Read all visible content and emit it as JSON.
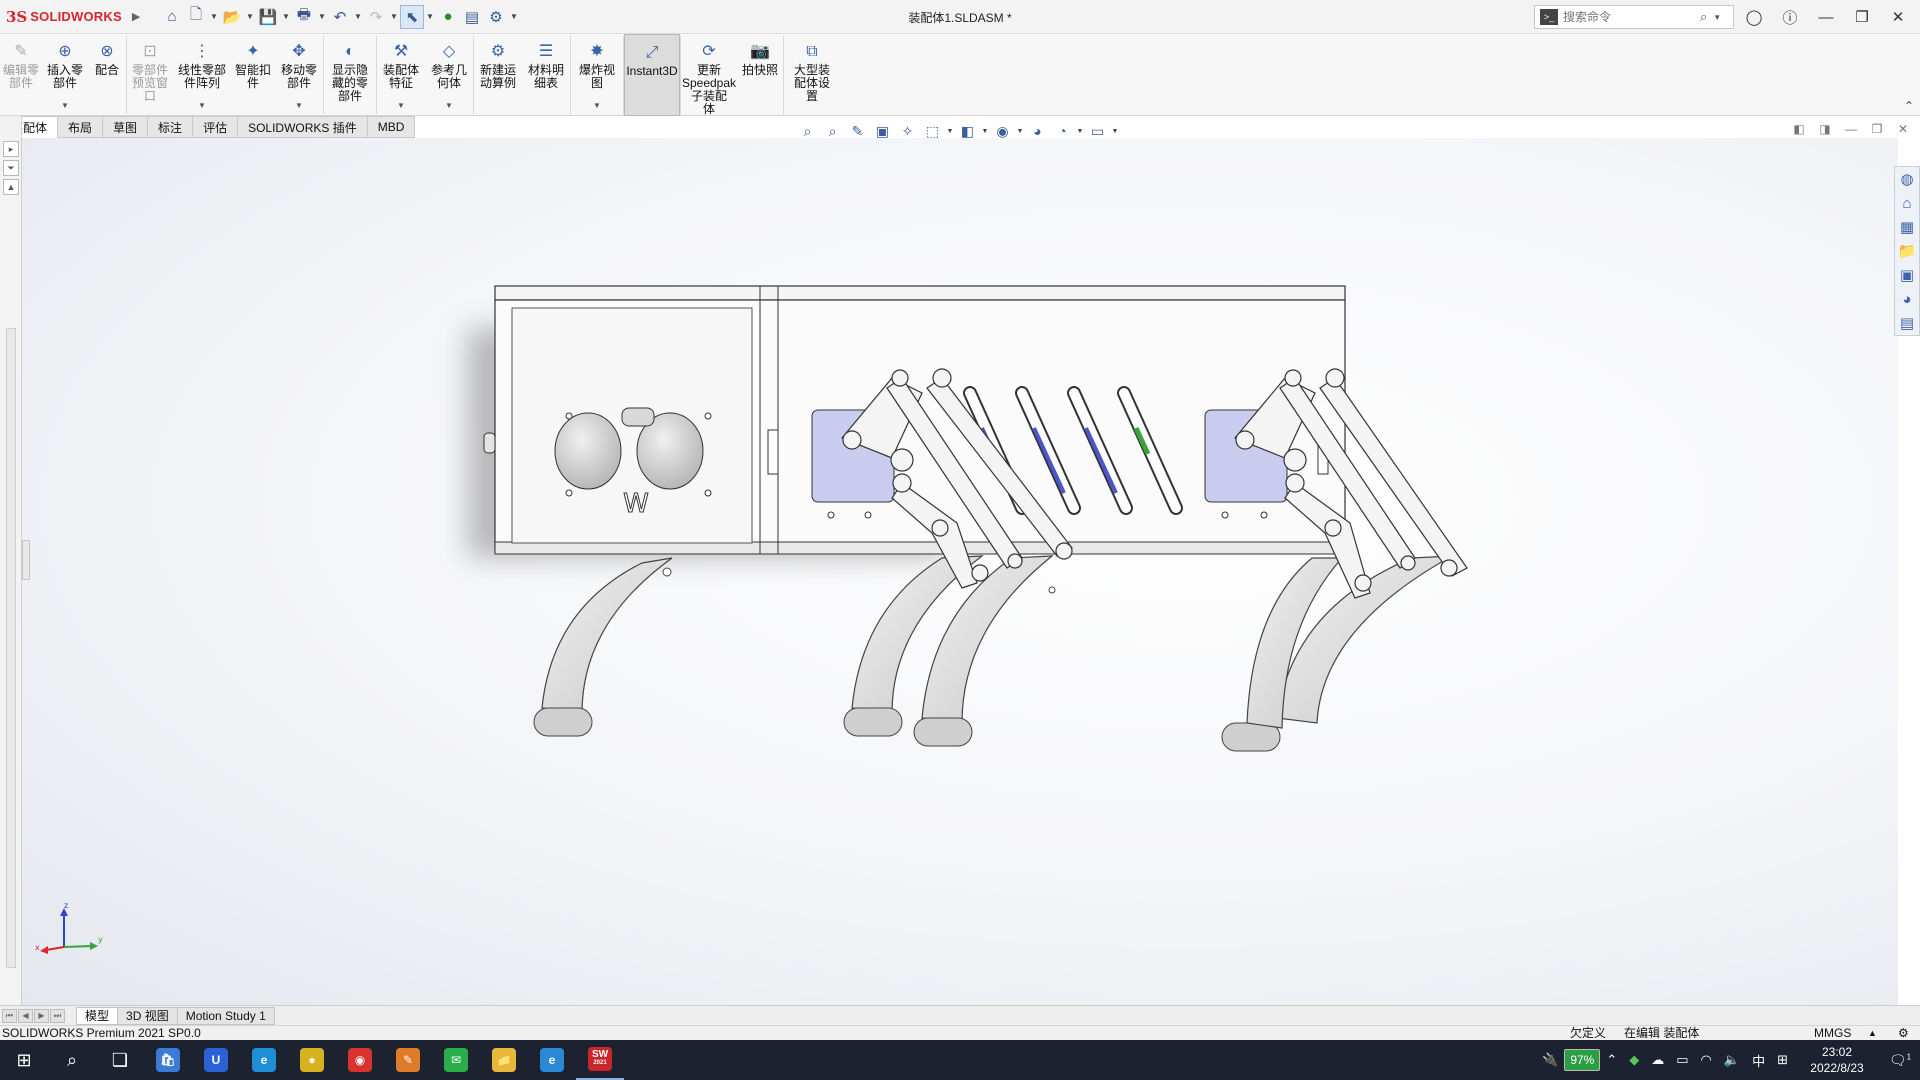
{
  "app": {
    "logo_ds": "3S",
    "logo_name": "SOLIDWORKS",
    "document_title": "装配体1.SLDASM *",
    "search_placeholder": "搜索命令"
  },
  "ribbon": {
    "buttons": [
      {
        "label": "编辑零\n部件",
        "icon": "edit-component-icon",
        "disabled": true,
        "caret": false
      },
      {
        "label": "插入零\n部件",
        "icon": "insert-component-icon",
        "disabled": false,
        "caret": true
      },
      {
        "label": "配合",
        "icon": "mate-icon",
        "disabled": false,
        "caret": false
      },
      {
        "label": "零部件\n预览窗\n口",
        "icon": "component-preview-icon",
        "disabled": true,
        "caret": false
      },
      {
        "label": "线性零部\n件阵列",
        "icon": "linear-pattern-icon",
        "disabled": false,
        "caret": true
      },
      {
        "label": "智能扣\n件",
        "icon": "smart-fasteners-icon",
        "disabled": false,
        "caret": false
      },
      {
        "label": "移动零\n部件",
        "icon": "move-component-icon",
        "disabled": false,
        "caret": true
      },
      {
        "label": "显示隐\n藏的零\n部件",
        "icon": "show-hidden-icon",
        "disabled": false,
        "caret": false
      },
      {
        "label": "装配体\n特征",
        "icon": "assembly-features-icon",
        "disabled": false,
        "caret": true
      },
      {
        "label": "参考几\n何体",
        "icon": "reference-geometry-icon",
        "disabled": false,
        "caret": true
      },
      {
        "label": "新建运\n动算例",
        "icon": "new-motion-study-icon",
        "disabled": false,
        "caret": false
      },
      {
        "label": "材料明\n细表",
        "icon": "bom-icon",
        "disabled": false,
        "caret": false
      },
      {
        "label": "爆炸视\n图",
        "icon": "exploded-view-icon",
        "disabled": false,
        "caret": true
      },
      {
        "label": "Instant3D",
        "icon": "instant3d-icon",
        "disabled": false,
        "caret": false,
        "active": true
      },
      {
        "label": "更新\nSpeedpak\n子装配\n体",
        "icon": "speedpak-icon",
        "disabled": false,
        "caret": false
      },
      {
        "label": "拍快照",
        "icon": "snapshot-icon",
        "disabled": false,
        "caret": false
      },
      {
        "label": "大型装\n配体设\n置",
        "icon": "large-assembly-icon",
        "disabled": false,
        "caret": false
      }
    ]
  },
  "tabs": [
    "装配体",
    "布局",
    "草图",
    "标注",
    "评估",
    "SOLIDWORKS 插件",
    "MBD"
  ],
  "bottom_tabs": [
    "模型",
    "3D 视图",
    "Motion Study 1"
  ],
  "status": {
    "product": "SOLIDWORKS Premium 2021 SP0.0",
    "underdefined": "欠定义",
    "editing": "在编辑 装配体",
    "units": "MMGS",
    "units_caret": "▲"
  },
  "model": {
    "label_w": "W"
  },
  "triad": {
    "x": "x",
    "y": "y",
    "z": "z"
  },
  "taskbar": {
    "battery": "97%",
    "ime": "中",
    "time": "23:02",
    "date": "2022/8/23",
    "notifications": "1",
    "apps": [
      {
        "name": "start",
        "icon": "windows-start-icon"
      },
      {
        "name": "search",
        "icon": "search-icon"
      },
      {
        "name": "task-view",
        "icon": "task-view-icon"
      },
      {
        "name": "store",
        "icon": "store-icon"
      },
      {
        "name": "shield",
        "icon": "shield-app-icon"
      },
      {
        "name": "edge",
        "icon": "edge-icon"
      },
      {
        "name": "app-yellow",
        "icon": "yellow-app-icon"
      },
      {
        "name": "netease",
        "icon": "netease-music-icon"
      },
      {
        "name": "app-orange",
        "icon": "orange-app-icon"
      },
      {
        "name": "wechat",
        "icon": "wechat-icon"
      },
      {
        "name": "explorer",
        "icon": "file-explorer-icon"
      },
      {
        "name": "ie",
        "icon": "ie-icon"
      },
      {
        "name": "solidworks",
        "icon": "solidworks-icon"
      }
    ],
    "solidworks_label": "SW",
    "solidworks_year": "2021"
  },
  "colors": {
    "brand": "#d7262c",
    "accent": "#3a63a8",
    "taskbar": "#1c2230"
  }
}
